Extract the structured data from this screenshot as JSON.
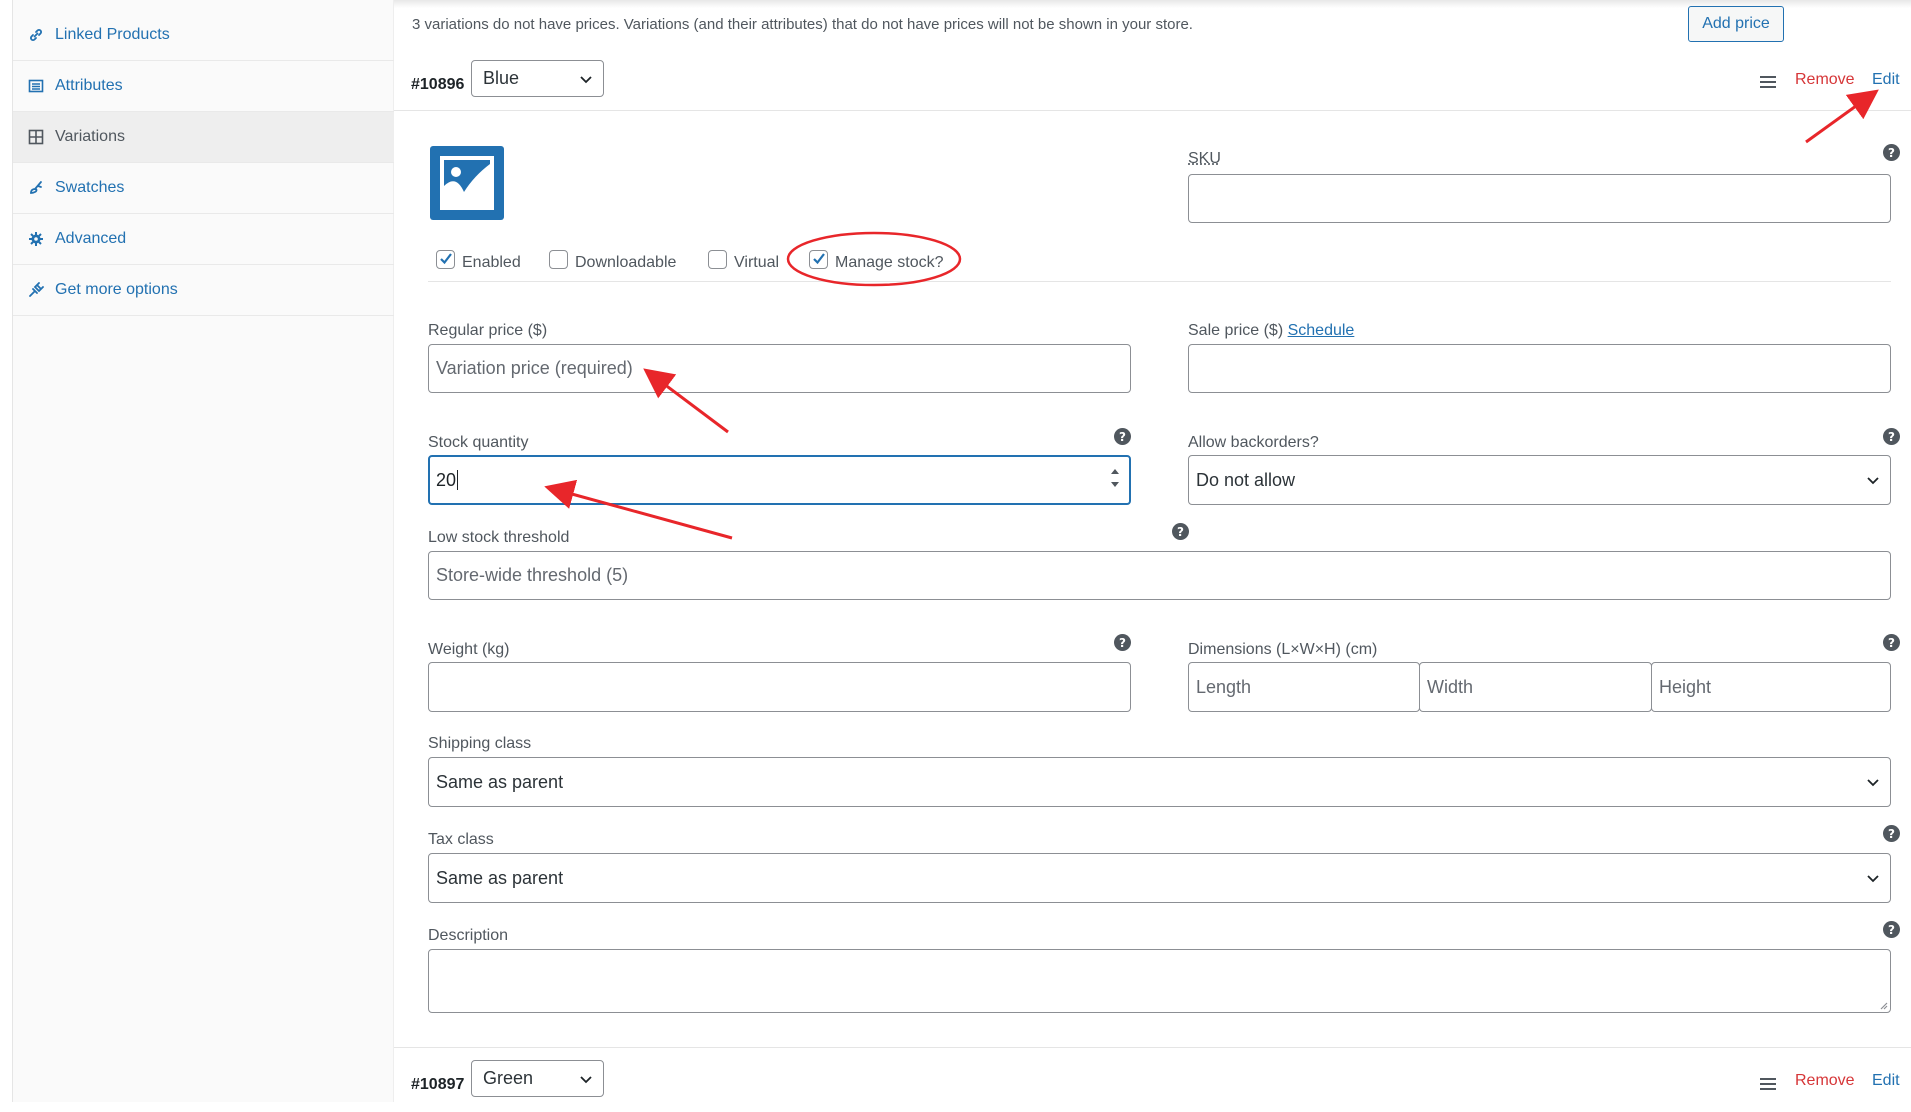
{
  "sidebar": {
    "items": [
      {
        "label": "Linked Products",
        "icon": "link-icon",
        "active": false
      },
      {
        "label": "Attributes",
        "icon": "list-icon",
        "active": false
      },
      {
        "label": "Variations",
        "icon": "grid-icon",
        "active": true
      },
      {
        "label": "Swatches",
        "icon": "swatch-icon",
        "active": false
      },
      {
        "label": "Advanced",
        "icon": "gear-icon",
        "active": false
      },
      {
        "label": "Get more options",
        "icon": "plug-icon",
        "active": false
      }
    ]
  },
  "notice": "3 variations do not have prices. Variations (and their attributes) that do not have prices will not be shown in your store.",
  "add_price_label": "Add price",
  "variation1": {
    "id": "#10896",
    "attribute_value": "Blue",
    "remove_label": "Remove",
    "edit_label": "Edit",
    "sku_label": "SKU",
    "sku_value": "",
    "checkboxes": {
      "enabled": {
        "label": "Enabled",
        "checked": true
      },
      "downloadable": {
        "label": "Downloadable",
        "checked": false
      },
      "virtual": {
        "label": "Virtual",
        "checked": false
      },
      "manage_stock": {
        "label": "Manage stock?",
        "checked": true
      }
    },
    "regular_price_label": "Regular price ($)",
    "regular_price_placeholder": "Variation price (required)",
    "sale_price_label": "Sale price ($)",
    "schedule_label": "Schedule",
    "stock_qty_label": "Stock quantity",
    "stock_qty_value": "20",
    "backorders_label": "Allow backorders?",
    "backorders_value": "Do not allow",
    "low_stock_label": "Low stock threshold",
    "low_stock_placeholder": "Store-wide threshold (5)",
    "weight_label": "Weight (kg)",
    "dimensions_label": "Dimensions (L×W×H) (cm)",
    "length_placeholder": "Length",
    "width_placeholder": "Width",
    "height_placeholder": "Height",
    "shipping_class_label": "Shipping class",
    "shipping_class_value": "Same as parent",
    "tax_class_label": "Tax class",
    "tax_class_value": "Same as parent",
    "description_label": "Description"
  },
  "variation2": {
    "id": "#10897",
    "attribute_value": "Green",
    "remove_label": "Remove",
    "edit_label": "Edit"
  },
  "colors": {
    "accent": "#2271b1",
    "danger": "#d63638",
    "annotation": "#e8262a"
  }
}
